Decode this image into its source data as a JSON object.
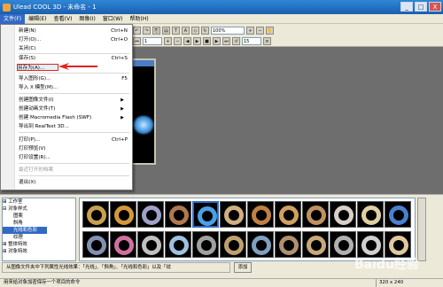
{
  "window": {
    "title": "Ulead COOL 3D - 未命名 - 1",
    "min": "_",
    "max": "□",
    "close": "X"
  },
  "menubar": [
    "文件(F)",
    "编辑(E)",
    "查看(V)",
    "图像(I)",
    "窗口(W)",
    "帮助(H)"
  ],
  "toolbar": {
    "zoom": "100%",
    "frame": "1",
    "fps": "15"
  },
  "file_menu": {
    "items": [
      {
        "label": "新建(N)",
        "shortcut": "Ctrl+N"
      },
      {
        "label": "打开(O)...",
        "shortcut": "Ctrl+O"
      },
      {
        "label": "关闭(C)",
        "shortcut": ""
      },
      {
        "label": "保存(S)",
        "shortcut": "Ctrl+S"
      },
      {
        "label": "另存为(A)...",
        "shortcut": ""
      },
      {
        "label": "导入图形(G)...",
        "shortcut": "F5"
      },
      {
        "label": "导入 X 模型(M)...",
        "shortcut": ""
      },
      {
        "label": "创建图像文件(I)",
        "shortcut": ""
      },
      {
        "label": "创建动画文件(T)",
        "shortcut": ""
      },
      {
        "label": "创建 Macromedia Flash (SWF)",
        "shortcut": ""
      },
      {
        "label": "导出到 RealText 3D...",
        "shortcut": ""
      },
      {
        "label": "打印(P)...",
        "shortcut": "Ctrl+P"
      },
      {
        "label": "打印预览(V)",
        "shortcut": ""
      },
      {
        "label": "打印设置(R)...",
        "shortcut": ""
      },
      {
        "label": "最近打开的档案",
        "shortcut": ""
      },
      {
        "label": "退出(X)",
        "shortcut": ""
      }
    ]
  },
  "tree": [
    "工作室",
    "对象样式",
    "图案",
    "斜角",
    "光线和色彩",
    "纹理",
    "整体特效",
    "对象特效"
  ],
  "description": "从图像文件夹中下列属性光线效果：「光线」、「斜角」、「光线和色彩」以及「纹",
  "add_button": "添加",
  "status": {
    "left": "用来给对象加密保存一个项目的命令",
    "right": "320 x 240"
  },
  "watermark": "Baidu经验",
  "colors": {
    "titlebar": "#1a5fb0",
    "highlight_border": "#e0241b",
    "selection": "#316ac5"
  },
  "thumb_colors": [
    "#c8a050",
    "#d29a3a",
    "#a0a0c8",
    "#b07850",
    "#4aa0e8",
    "#d0b080",
    "#c08040",
    "#d0a060",
    "#c09060",
    "#d8d0c8",
    "#e0d0a0",
    "#4a80d0",
    "#8090b0",
    "#d070a0",
    "#c0c0c0",
    "#a0c0e0",
    "#a0a0a0",
    "#c0a070",
    "#80a0c0",
    "#b09070",
    "#c8a878",
    "#b0b0b0",
    "#d0d0d0",
    "#e0c8a0"
  ]
}
